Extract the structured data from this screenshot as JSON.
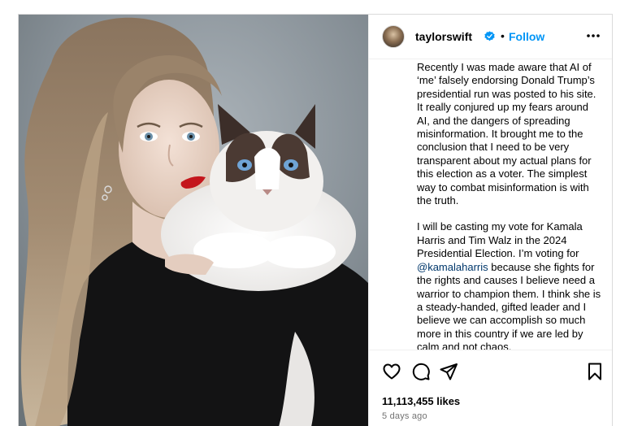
{
  "post": {
    "image_alt": "Woman with long wavy hair and red lipstick holding a fluffy ragdoll cat",
    "header": {
      "username": "taylorswift",
      "separator": "•",
      "follow_label": "Follow",
      "more_icon": "more-horizontal-icon",
      "verified_icon": "verified-badge-icon"
    },
    "caption": {
      "paragraph1": "Recently I was made aware that AI of ‘me’ falsely endorsing Donald Trump’s presidential run was posted to his site. It really conjured up my fears around AI, and the dangers of spreading misinformation. It brought me to the conclusion that I need to be very transparent about my actual plans for this election as a voter. The simplest way to combat misinformation is with the truth.",
      "paragraph2_a": "I will be casting my vote for Kamala Harris and Tim Walz in the 2024 Presidential Election. I’m voting for ",
      "mention": "@kamalaharris",
      "paragraph2_b": " because she fights for the rights and causes I believe need a warrior to champion them. I think she is a steady-handed, gifted leader and I believe we can accomplish so much more in this country if we are led by calm and not chaos."
    },
    "actions": {
      "like_icon": "heart-icon",
      "comment_icon": "comment-icon",
      "share_icon": "share-icon",
      "save_icon": "bookmark-icon"
    },
    "likes": "11,113,455 likes",
    "time": "5 days ago",
    "colors": {
      "follow": "#0095f6",
      "verified": "#0095f6",
      "mention": "#00376b",
      "muted": "#737373"
    }
  }
}
